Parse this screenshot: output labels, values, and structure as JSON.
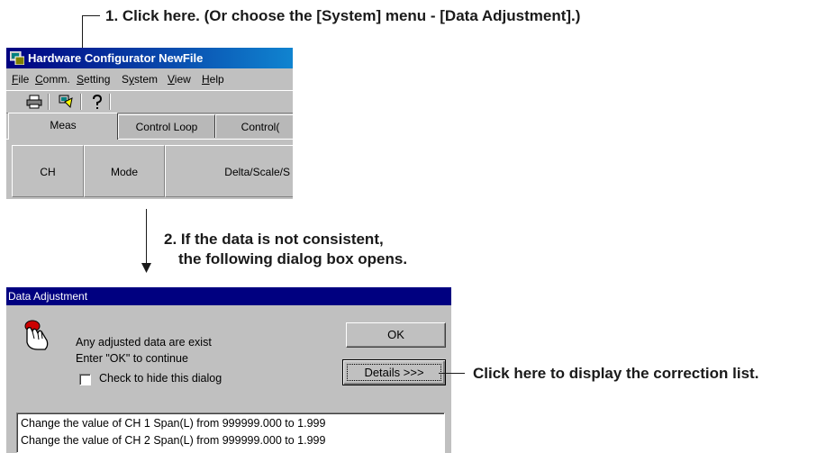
{
  "callouts": {
    "step1": "1. Click here. (Or choose the [System] menu - [Data Adjustment].)",
    "step2_line1": "2. If the data is not consistent,",
    "step2_line2": "the following dialog box opens.",
    "details_hint": "Click here to display the correction list."
  },
  "main_window": {
    "title": "Hardware Configurator NewFile",
    "menu": [
      "File",
      "Comm.",
      "Setting",
      "System",
      "View",
      "Help"
    ],
    "toolbar_icons": [
      "printer-icon",
      "data-adjustment-icon",
      "help-icon"
    ],
    "tabs": [
      "Meas",
      "Control Loop",
      "Control("
    ],
    "columns": [
      "CH",
      "Mode",
      "Delta/Scale/S"
    ]
  },
  "dialog": {
    "title": "Data Adjustment",
    "icon": "hand-pointer-icon",
    "message_line1": "Any adjusted data are exist",
    "message_line2": "Enter \"OK\" to continue",
    "checkbox_label": "Check to hide this dialog",
    "checkbox_checked": false,
    "ok_label": "OK",
    "details_label": "Details >>>",
    "list": [
      "Change the value of CH 1 Span(L) from 999999.000 to 1.999",
      "Change the value of CH 2 Span(L) from 999999.000 to 1.999"
    ]
  },
  "colors": {
    "titlebar": "#000080",
    "face": "#c0c0c0"
  }
}
